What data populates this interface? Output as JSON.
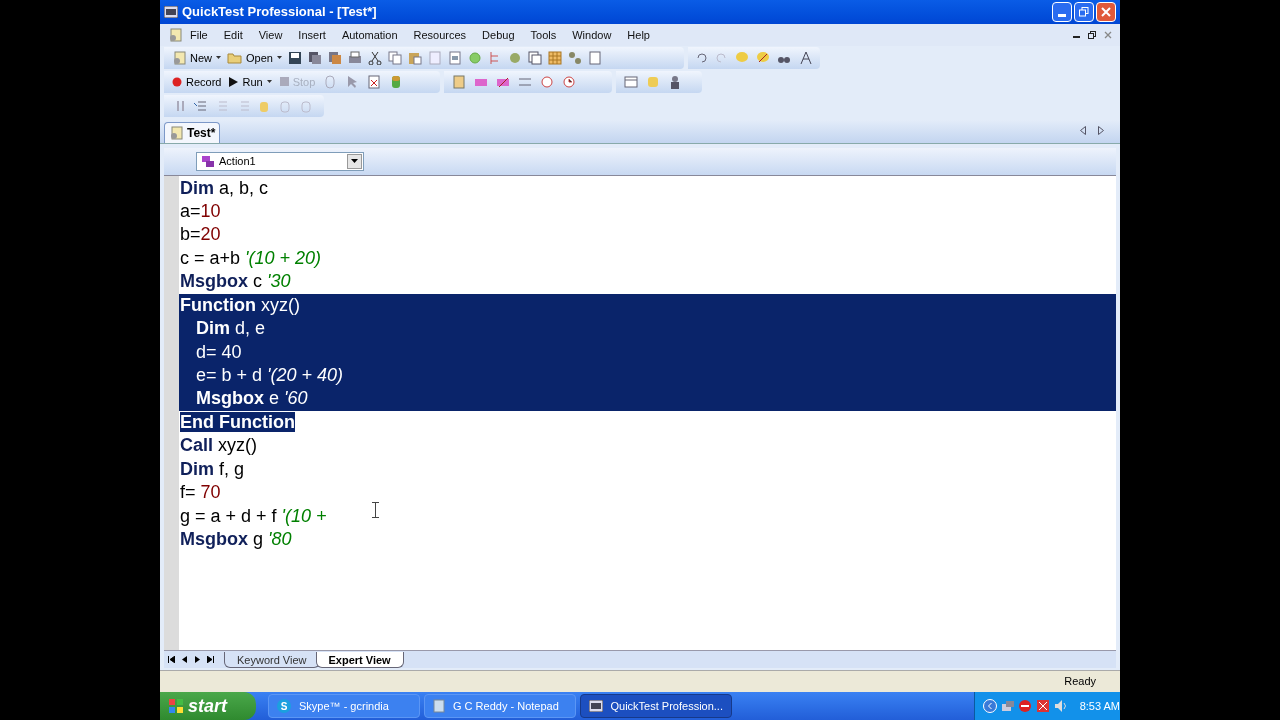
{
  "window": {
    "title": "QuickTest Professional - [Test*]"
  },
  "menu": [
    "File",
    "Edit",
    "View",
    "Insert",
    "Automation",
    "Resources",
    "Debug",
    "Tools",
    "Window",
    "Help"
  ],
  "toolbar": {
    "new": "New",
    "open": "Open",
    "record": "Record",
    "run": "Run",
    "stop": "Stop",
    "stop_disabled": true
  },
  "document_tab": {
    "label": "Test*",
    "selected": true
  },
  "action_selector": {
    "value": "Action1"
  },
  "code_lines": [
    {
      "selected": false,
      "tokens": [
        {
          "kind": "keyword",
          "text": "Dim"
        },
        {
          "kind": "plain",
          "text": " a, b, c"
        }
      ]
    },
    {
      "selected": false,
      "tokens": [
        {
          "kind": "plain",
          "text": "a="
        },
        {
          "kind": "number",
          "text": "10"
        }
      ]
    },
    {
      "selected": false,
      "tokens": [
        {
          "kind": "plain",
          "text": "b="
        },
        {
          "kind": "number",
          "text": "20"
        }
      ]
    },
    {
      "selected": false,
      "tokens": [
        {
          "kind": "plain",
          "text": "c = a+b "
        },
        {
          "kind": "comment",
          "text": "'(10 + 20)"
        }
      ]
    },
    {
      "selected": false,
      "tokens": [
        {
          "kind": "keyword",
          "text": "Msgbox"
        },
        {
          "kind": "plain",
          "text": " c "
        },
        {
          "kind": "comment",
          "text": "'30"
        }
      ]
    },
    {
      "selected": true,
      "full_width": true,
      "tokens": [
        {
          "kind": "keyword",
          "text": "Function"
        },
        {
          "kind": "plain",
          "text": " xyz()"
        }
      ],
      "children": [
        {
          "selected": true,
          "full_width": true,
          "tokens": [
            {
              "kind": "keyword",
              "text": "Dim"
            },
            {
              "kind": "plain",
              "text": " d, e"
            }
          ]
        },
        {
          "selected": true,
          "full_width": true,
          "tokens": [
            {
              "kind": "plain",
              "text": "d= "
            },
            {
              "kind": "number",
              "text": "40"
            }
          ]
        },
        {
          "selected": true,
          "full_width": true,
          "tokens": [
            {
              "kind": "plain",
              "text": "e= b + d "
            },
            {
              "kind": "comment",
              "text": "'(20 + 40)"
            }
          ]
        },
        {
          "selected": true,
          "full_width": true,
          "tokens": [
            {
              "kind": "keyword",
              "text": "Msgbox"
            },
            {
              "kind": "plain",
              "text": " e "
            },
            {
              "kind": "comment",
              "text": "'60"
            }
          ]
        }
      ]
    },
    {
      "selected": true,
      "full_width": false,
      "tokens": [
        {
          "kind": "keyword",
          "text": "End Function"
        }
      ]
    },
    {
      "selected": false,
      "tokens": [
        {
          "kind": "keyword",
          "text": "Call"
        },
        {
          "kind": "plain",
          "text": " xyz()"
        }
      ]
    },
    {
      "selected": false,
      "tokens": [
        {
          "kind": "keyword",
          "text": "Dim"
        },
        {
          "kind": "plain",
          "text": " f, g"
        }
      ]
    },
    {
      "selected": false,
      "tokens": [
        {
          "kind": "plain",
          "text": "f= "
        },
        {
          "kind": "number",
          "text": "70"
        }
      ]
    },
    {
      "selected": false,
      "tokens": [
        {
          "kind": "plain",
          "text": "g = a + d + f "
        },
        {
          "kind": "comment",
          "text": "'(10 +"
        }
      ]
    },
    {
      "selected": false,
      "tokens": [
        {
          "kind": "keyword",
          "text": "Msgbox"
        },
        {
          "kind": "plain",
          "text": " g "
        },
        {
          "kind": "comment",
          "text": "'80"
        }
      ]
    }
  ],
  "view_tabs": [
    {
      "label": "Keyword View",
      "selected": false
    },
    {
      "label": "Expert View",
      "selected": true
    }
  ],
  "status_bar": {
    "text": "Ready"
  },
  "taskbar": {
    "start": "start",
    "tasks": [
      {
        "label": "Skype™ - gcrindia",
        "icon": "S",
        "selected": false
      },
      {
        "label": "G C Reddy - Notepad",
        "selected": false
      },
      {
        "label": "QuickTest Profession...",
        "selected": true
      }
    ],
    "clock": "8:53 AM"
  }
}
